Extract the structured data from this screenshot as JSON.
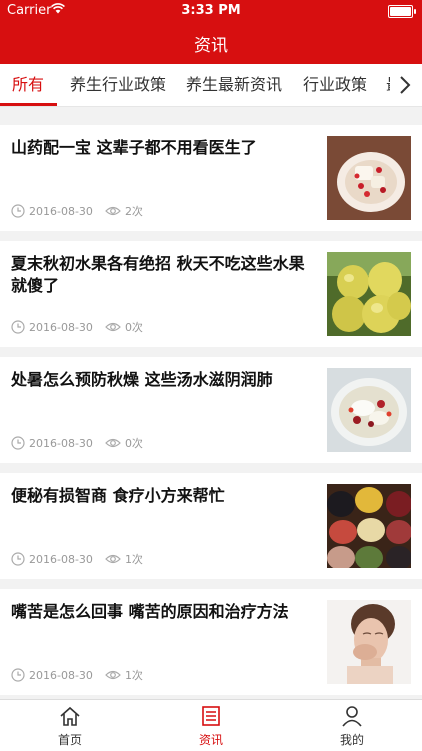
{
  "status": {
    "carrier": "Carrier",
    "time": "3:33 PM"
  },
  "header": {
    "title": "资讯"
  },
  "tabs": [
    "所有",
    "养生行业政策",
    "养生最新资讯",
    "行业政策",
    "最"
  ],
  "articles": [
    {
      "title": "山药配一宝 这辈子都不用看医生了",
      "date": "2016-08-30",
      "views": "2次"
    },
    {
      "title": "夏末秋初水果各有绝招 秋天不吃这些水果就傻了",
      "date": "2016-08-30",
      "views": "0次"
    },
    {
      "title": "处暑怎么预防秋燥 这些汤水滋阴润肺",
      "date": "2016-08-30",
      "views": "0次"
    },
    {
      "title": "便秘有损智商 食疗小方来帮忙",
      "date": "2016-08-30",
      "views": "1次"
    },
    {
      "title": "嘴苦是怎么回事 嘴苦的原因和治疗方法",
      "date": "2016-08-30",
      "views": "1次"
    }
  ],
  "tabbar": {
    "home": "首页",
    "news": "资讯",
    "mine": "我的"
  },
  "colors": {
    "brand": "#d70f10"
  }
}
